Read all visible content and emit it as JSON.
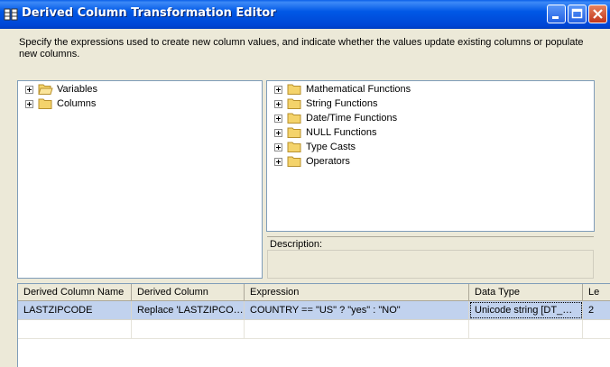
{
  "window": {
    "title": "Derived Column Transformation Editor"
  },
  "instructions": "Specify the expressions used to create new column values, and indicate whether the values update existing columns or populate new columns.",
  "left_tree": {
    "items": [
      {
        "label": "Variables"
      },
      {
        "label": "Columns"
      }
    ]
  },
  "right_tree": {
    "items": [
      {
        "label": "Mathematical Functions"
      },
      {
        "label": "String Functions"
      },
      {
        "label": "Date/Time Functions"
      },
      {
        "label": "NULL Functions"
      },
      {
        "label": "Type Casts"
      },
      {
        "label": "Operators"
      }
    ]
  },
  "description": {
    "label": "Description:",
    "text": ""
  },
  "grid": {
    "columns": [
      "Derived Column Name",
      "Derived Column",
      "Expression",
      "Data Type",
      "Le"
    ],
    "rows": [
      {
        "name": "LASTZIPCODE",
        "derived": "Replace 'LASTZIPCO…",
        "expression": "COUNTRY == \"US\" ? \"yes\" : \"NO\"",
        "type": "Unicode string [DT_…",
        "length": "2"
      }
    ]
  },
  "colors": {
    "titlebar": "#0054E3",
    "selection": "#C1D2EE",
    "face": "#ECE9D8",
    "border": "#7F9DB9"
  }
}
